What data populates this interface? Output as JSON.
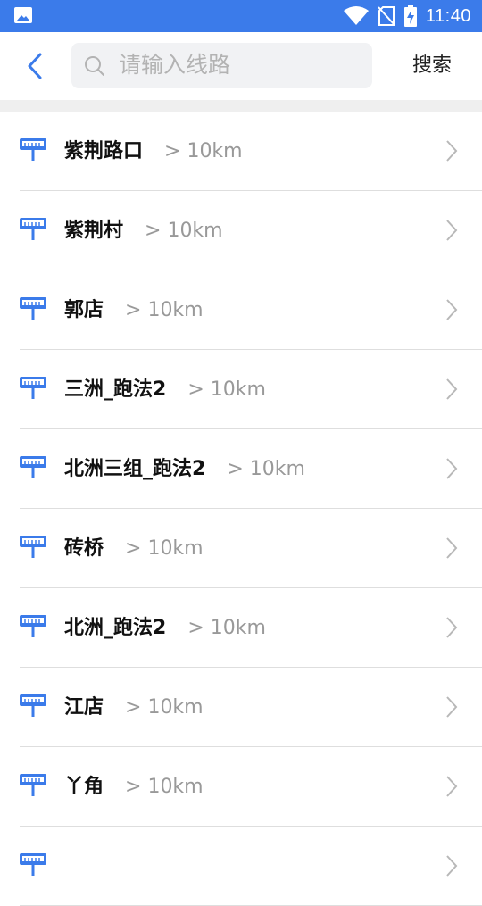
{
  "status_bar": {
    "time": "11:40",
    "icons": [
      "image-icon",
      "wifi-icon",
      "no-sim-icon",
      "battery-charging-icon"
    ]
  },
  "header": {
    "back_icon": "chevron-left-icon",
    "search_placeholder": "请输入线路",
    "search_button": "搜索"
  },
  "colors": {
    "primary": "#3b7bea",
    "text": "#111111",
    "secondary_text": "#999999",
    "divider": "#dedede",
    "search_bg": "#f1f2f4"
  },
  "stations": [
    {
      "name": "紫荆路口",
      "distance": "> 10km"
    },
    {
      "name": "紫荆村",
      "distance": "> 10km"
    },
    {
      "name": "郭店",
      "distance": "> 10km"
    },
    {
      "name": "三洲_跑法2",
      "distance": "> 10km"
    },
    {
      "name": "北洲三组_跑法2",
      "distance": "> 10km"
    },
    {
      "name": "砖桥",
      "distance": "> 10km"
    },
    {
      "name": "北洲_跑法2",
      "distance": "> 10km"
    },
    {
      "name": "江店",
      "distance": "> 10km"
    },
    {
      "name": "丫角",
      "distance": "> 10km"
    },
    {
      "name": "",
      "distance": ""
    }
  ]
}
